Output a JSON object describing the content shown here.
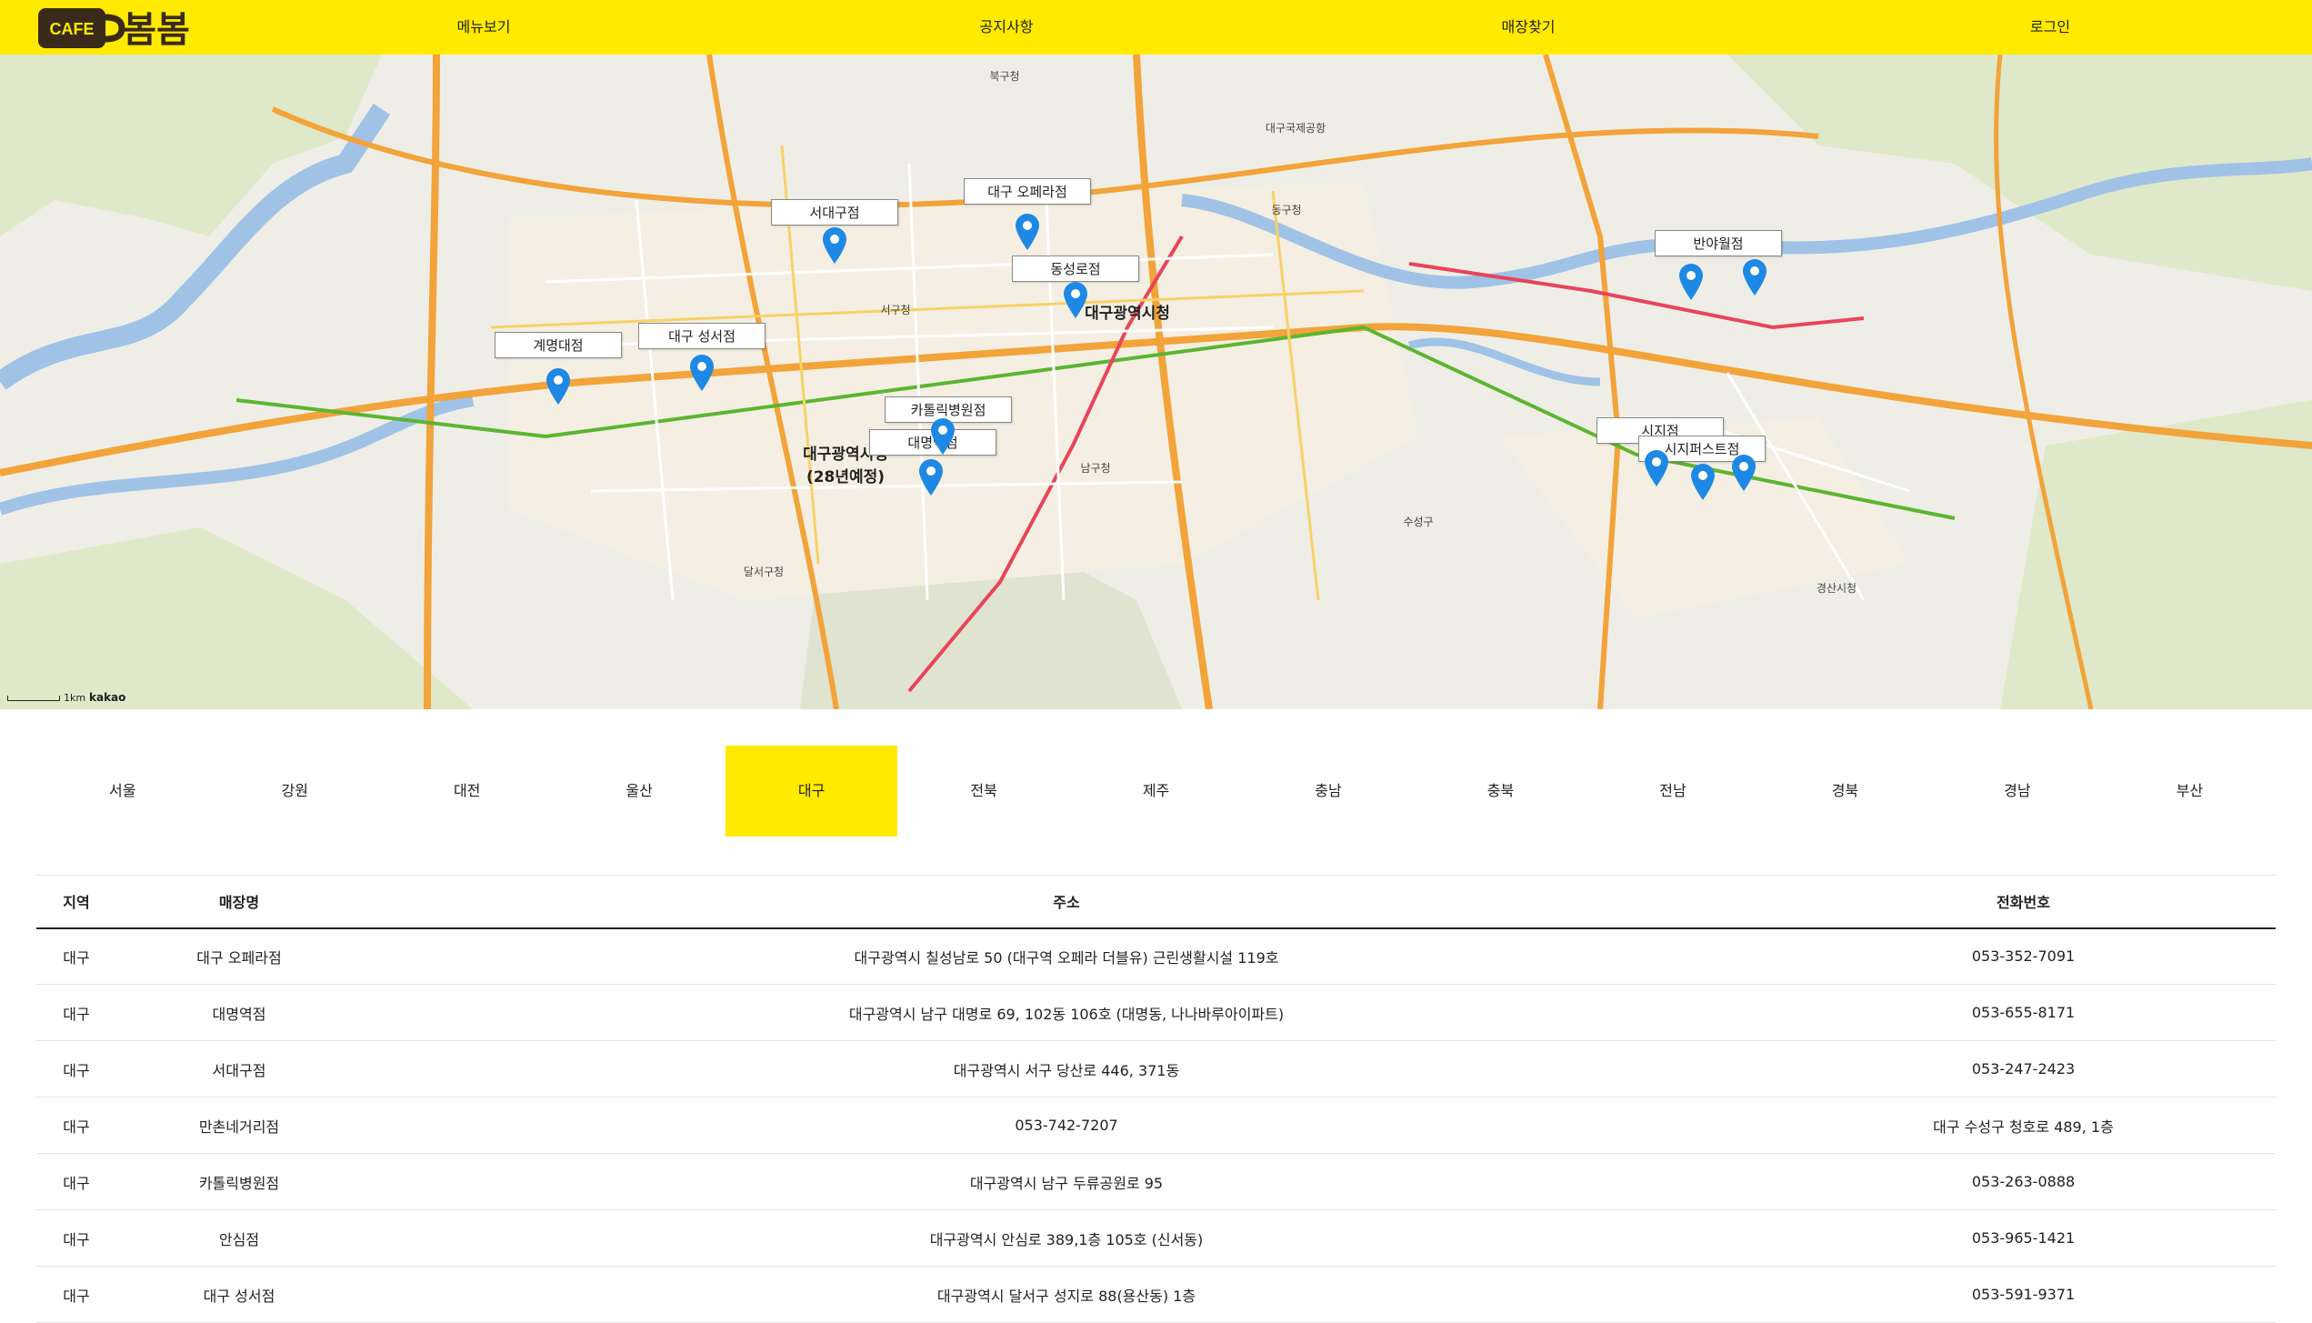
{
  "header": {
    "logo_cafe": "CAFE",
    "logo_name": "봄봄",
    "nav": [
      "메뉴보기",
      "공지사항",
      "매장찾기",
      "로그인"
    ]
  },
  "map": {
    "stores": [
      "서대구점",
      "대구 오페라점",
      "동성로점",
      "계명대점",
      "대구 성서점",
      "카톨릭병원점",
      "대명역점",
      "반야월점",
      "시지점",
      "시지퍼스트점"
    ],
    "places": [
      "대구광역시청",
      "대구광역시청\n(28년예정)",
      "동구청",
      "서구청",
      "남구청",
      "달서구청",
      "수성구",
      "경산시청",
      "대구국제공항",
      "북구청"
    ],
    "scale": "1km",
    "brand": "kakao"
  },
  "tabs": {
    "items": [
      "서울",
      "강원",
      "대전",
      "울산",
      "대구",
      "전북",
      "제주",
      "충남",
      "충북",
      "전남",
      "경북",
      "경남",
      "부산"
    ],
    "active_index": 4
  },
  "table": {
    "headers": [
      "지역",
      "매장명",
      "주소",
      "전화번호"
    ],
    "rows": [
      [
        "대구",
        "대구 오페라점",
        "대구광역시 칠성남로 50 (대구역 오페라 더블유) 근린생활시설 119호",
        "053-352-7091"
      ],
      [
        "대구",
        "대명역점",
        "대구광역시 남구 대명로 69, 102동 106호 (대명동, 나나바루아이파트)",
        "053-655-8171"
      ],
      [
        "대구",
        "서대구점",
        "대구광역시 서구 당산로 446, 371동",
        "053-247-2423"
      ],
      [
        "대구",
        "만촌네거리점",
        "053-742-7207",
        "대구 수성구 청호로 489, 1층"
      ],
      [
        "대구",
        "카톨릭병원점",
        "대구광역시 남구 두류공원로 95",
        "053-263-0888"
      ],
      [
        "대구",
        "안심점",
        "대구광역시 안심로 389,1층 105호 (신서동)",
        "053-965-1421"
      ],
      [
        "대구",
        "대구 성서점",
        "대구광역시 달서구 성지로 88(용산동) 1층",
        "053-591-9371"
      ]
    ]
  },
  "colors": {
    "brand_yellow": "#ffea00",
    "marker_blue": "#1e88e5"
  }
}
